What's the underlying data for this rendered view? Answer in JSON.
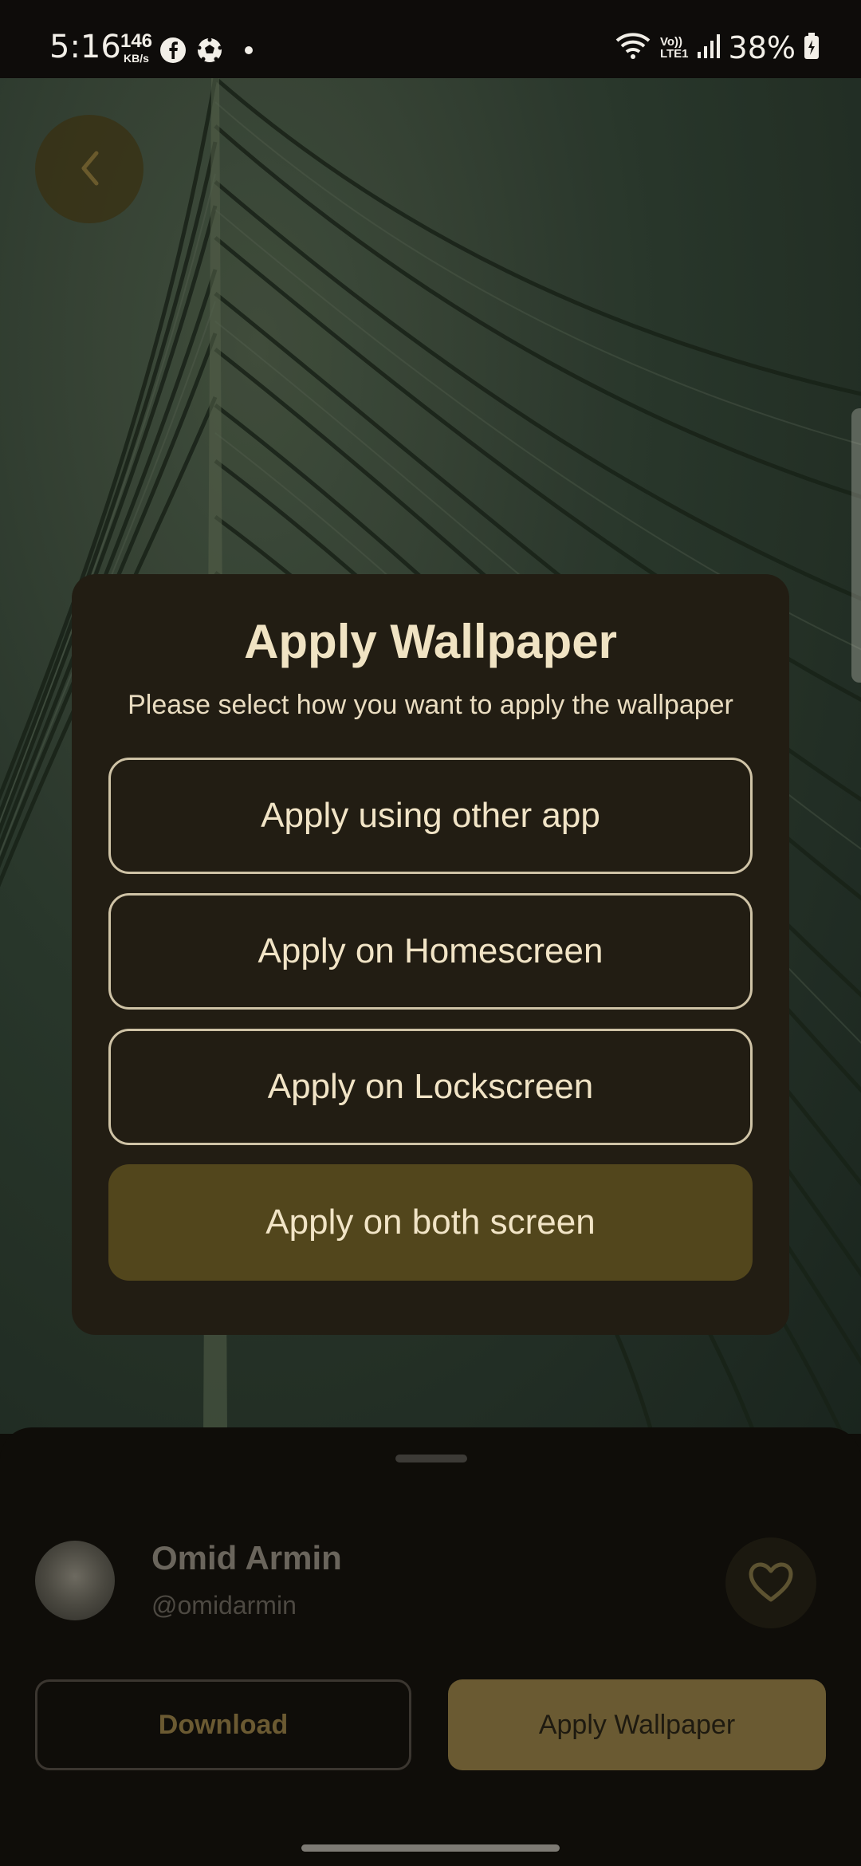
{
  "status_bar": {
    "time": "5:16",
    "net_speed_value": "146",
    "net_speed_unit": "KB/s",
    "icons": [
      "facebook-icon",
      "soccer-ball-icon",
      "dot-icon",
      "wifi-icon",
      "volte-icon",
      "signal-icon",
      "battery-icon"
    ],
    "volte_label_top": "Vo))",
    "volte_label_bottom": "LTE1",
    "battery": "38%"
  },
  "dialog": {
    "title": "Apply Wallpaper",
    "subtitle": "Please select how you want to apply the wallpaper",
    "options": [
      {
        "label": "Apply using other app"
      },
      {
        "label": "Apply on Homescreen"
      },
      {
        "label": "Apply on Lockscreen"
      },
      {
        "label": "Apply on both screen"
      }
    ]
  },
  "author": {
    "name": "Omid Armin",
    "handle": "@omidarmin"
  },
  "actions": {
    "download": "Download",
    "apply": "Apply Wallpaper"
  },
  "colors": {
    "dialog_bg": "#221d13",
    "accent": "#52461c",
    "text": "#f1e4c6"
  }
}
